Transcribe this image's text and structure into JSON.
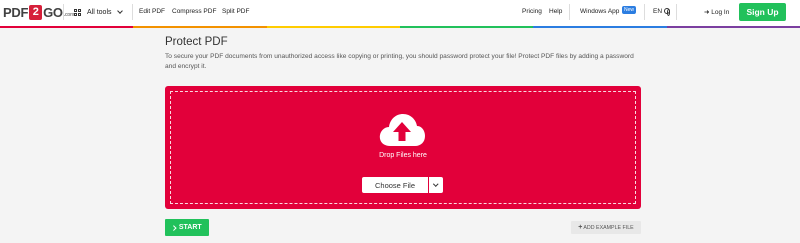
{
  "header": {
    "logo": {
      "part1": "PDF",
      "part2": "2",
      "part3": "GO",
      "suffix": ".com"
    },
    "all_tools": "All tools",
    "nav": [
      "Edit PDF",
      "Compress PDF",
      "Split PDF"
    ],
    "right_nav": {
      "pricing": "Pricing",
      "help": "Help",
      "windows_app": "Windows App",
      "new_badge": "New",
      "language": "EN",
      "login": "Log In",
      "signup": "Sign Up"
    }
  },
  "stripe_colors": [
    "#e2003a",
    "#f39200",
    "#ffcc00",
    "#21c15b",
    "#2b7de1",
    "#7b3fa0"
  ],
  "main": {
    "title": "Protect PDF",
    "description": "To secure your PDF documents from unauthorized access like copying or printing, you should password protect your file! Protect PDF files by adding a password and encrypt it.",
    "dropzone": {
      "drop_text": "Drop Files here",
      "choose_file": "Choose File",
      "color": "#e2003a"
    },
    "start": "START",
    "add_example": "ADD EXAMPLE FILE"
  },
  "icons": {
    "logo": "pdf2go-logo",
    "tools": "grid-icon",
    "language": "globe-icon",
    "login": "login-arrow-icon",
    "upload": "cloud-upload-icon",
    "dropdown": "chevron-down-icon",
    "start": "chevron-right-icon",
    "add": "plus-icon"
  },
  "accent_colors": {
    "primary_red": "#e2003a",
    "green": "#21c15b",
    "badge_blue": "#2b7de1"
  }
}
